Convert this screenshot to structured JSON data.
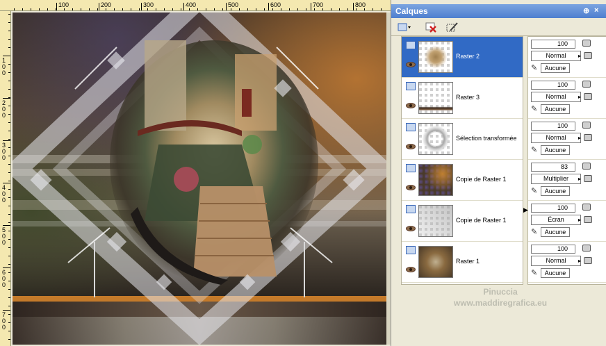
{
  "panel": {
    "title": "Calques",
    "pin_glyph": "⊕",
    "close_glyph": "×"
  },
  "ruler": {
    "top_labels": [
      "100",
      "200",
      "300",
      "400",
      "500",
      "600",
      "700",
      "800"
    ],
    "left_labels": [
      "1\n0\n0",
      "2\n0\n0",
      "3\n0\n0",
      "4\n0\n0",
      "5\n0\n0",
      "6\n0\n0",
      "7\n0\n0"
    ]
  },
  "toolbar": {
    "new_layer_icon": "new-layer-icon",
    "delete_icon": "delete-layer-icon",
    "edit_icon": "edit-selection-icon"
  },
  "layers": [
    {
      "name": "Raster 2",
      "selected": true,
      "opacity": "100",
      "blend": "Normal",
      "mask": "Aucune"
    },
    {
      "name": "Raster 3",
      "selected": false,
      "opacity": "100",
      "blend": "Normal",
      "mask": "Aucune"
    },
    {
      "name": "Sélection transformée",
      "selected": false,
      "opacity": "100",
      "blend": "Normal",
      "mask": "Aucune"
    },
    {
      "name": "Copie de Raster 1",
      "selected": false,
      "opacity": "83",
      "blend": "Multiplier",
      "mask": "Aucune"
    },
    {
      "name": "Copie de Raster 1",
      "selected": false,
      "opacity": "100",
      "blend": "Écran",
      "mask": "Aucune"
    },
    {
      "name": "Raster 1",
      "selected": false,
      "opacity": "100",
      "blend": "Normal",
      "mask": "Aucune"
    }
  ],
  "watermark": {
    "line1": "Pinuccia",
    "line2": "www.maddiregrafica.eu"
  }
}
